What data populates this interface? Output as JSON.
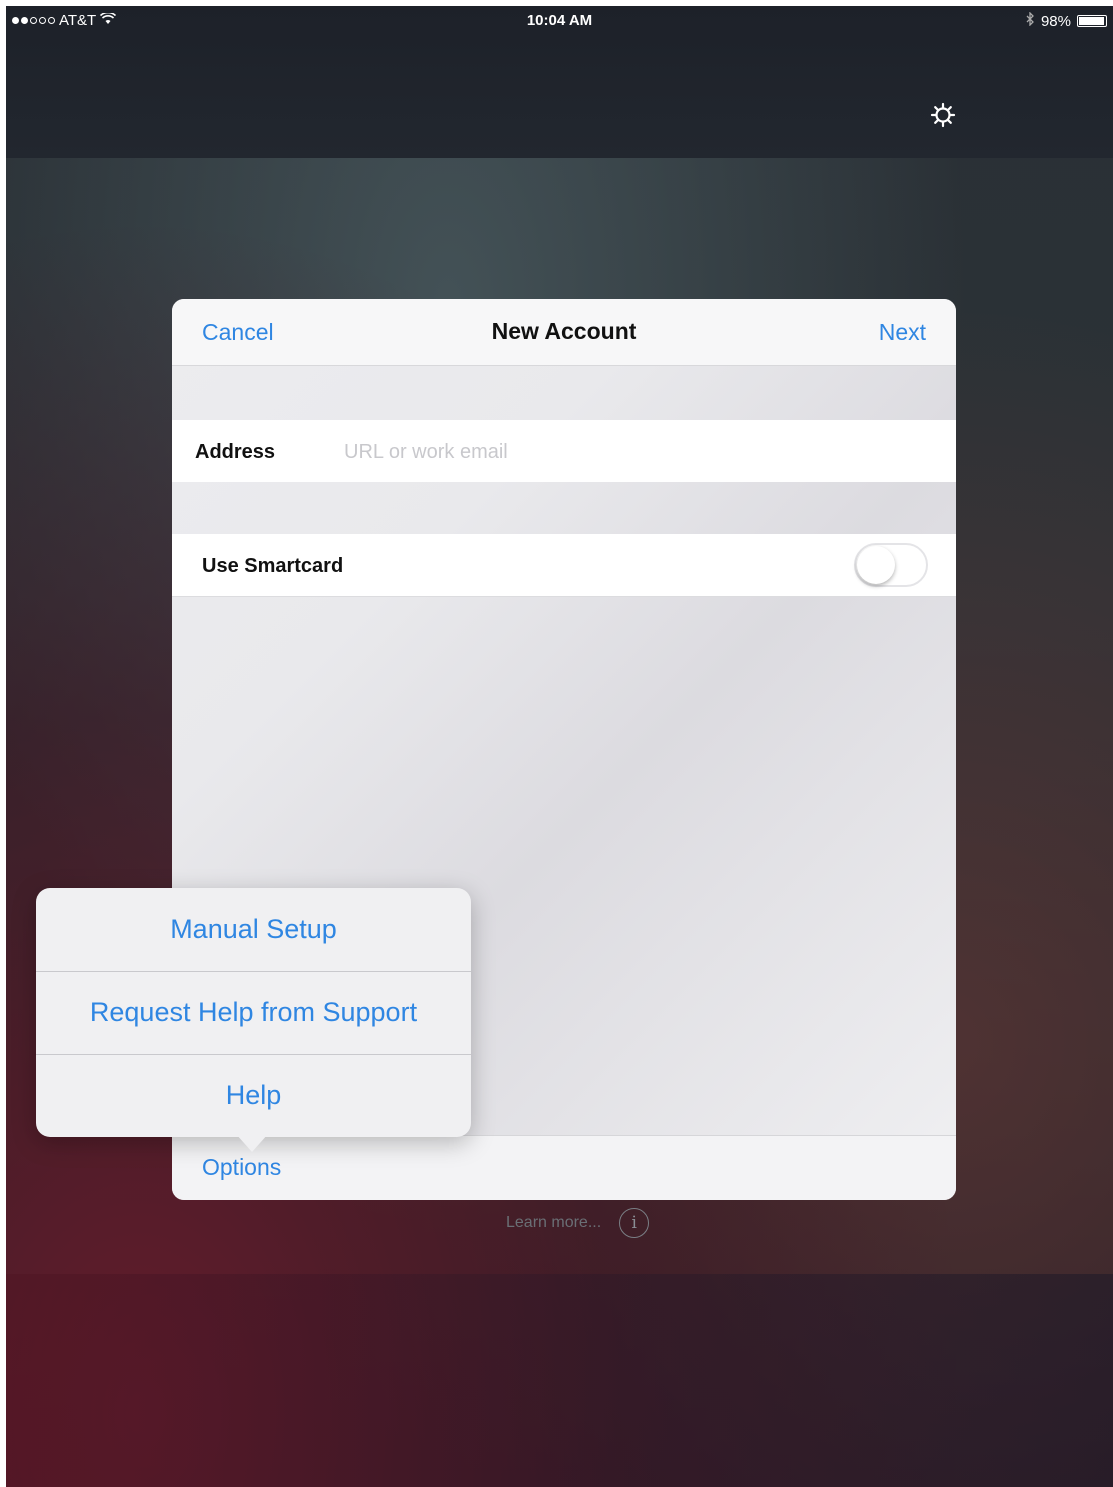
{
  "status_bar": {
    "carrier": "AT&T",
    "time": "10:04 AM",
    "battery": "98%",
    "battery_level": 0.98,
    "signal_bars_filled": 2,
    "signal_bars_total": 5
  },
  "header": {
    "settings_icon": "gear-icon"
  },
  "dialog": {
    "title": "New Account",
    "cancel_label": "Cancel",
    "next_label": "Next",
    "address": {
      "label": "Address",
      "value": "",
      "placeholder": "URL or work email"
    },
    "smartcard": {
      "label": "Use Smartcard",
      "enabled": false
    },
    "options_label": "Options"
  },
  "popover": {
    "items": [
      {
        "label": "Manual Setup"
      },
      {
        "label": "Request Help from Support"
      },
      {
        "label": "Help"
      }
    ]
  },
  "footer": {
    "learn_more": "Learn more...",
    "info_icon": "info-icon",
    "info_glyph": "i"
  },
  "colors": {
    "accent": "#2f86e2",
    "toggle_off_border": "#e4e4e7"
  }
}
